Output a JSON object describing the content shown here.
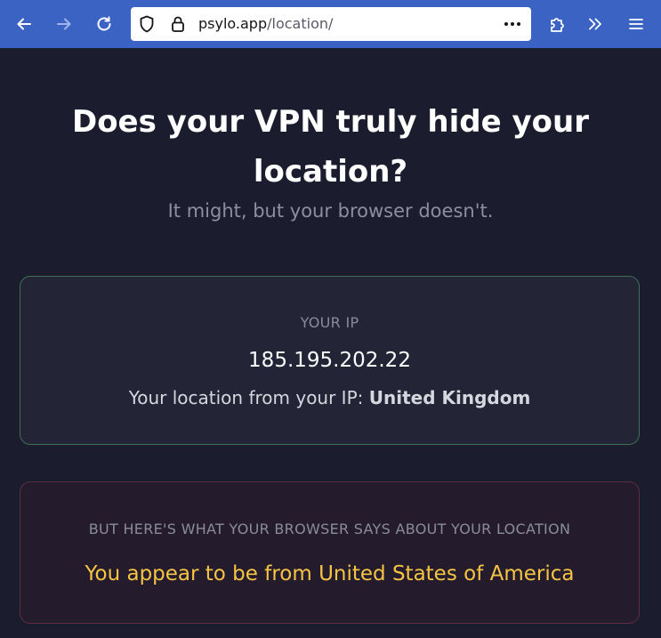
{
  "browser": {
    "url_host": "psylo.app",
    "url_path": "/location/",
    "toolbar_color": "#3a63c4",
    "icons": [
      "back-icon",
      "forward-icon",
      "reload-icon",
      "shield-icon",
      "lock-icon",
      "more-icon",
      "extensions-icon",
      "overflow-icon",
      "menu-icon"
    ]
  },
  "page": {
    "headline": "Does your VPN truly hide your location?",
    "subhead": "It might, but your browser doesn't.",
    "ip_card": {
      "label": "YOUR IP",
      "ip": "185.195.202.22",
      "location_prefix": "Your location from your IP: ",
      "location_country": "United Kingdom"
    },
    "browser_card": {
      "label": "BUT HERE'S WHAT YOUR BROWSER SAYS ABOUT YOUR LOCATION",
      "location_text": "You appear to be from United States of America"
    },
    "colors": {
      "background": "#1b1c2e",
      "ip_card_border": "#3f6f55",
      "browser_card_border": "#5c2f40",
      "highlight": "#f6c445"
    }
  }
}
